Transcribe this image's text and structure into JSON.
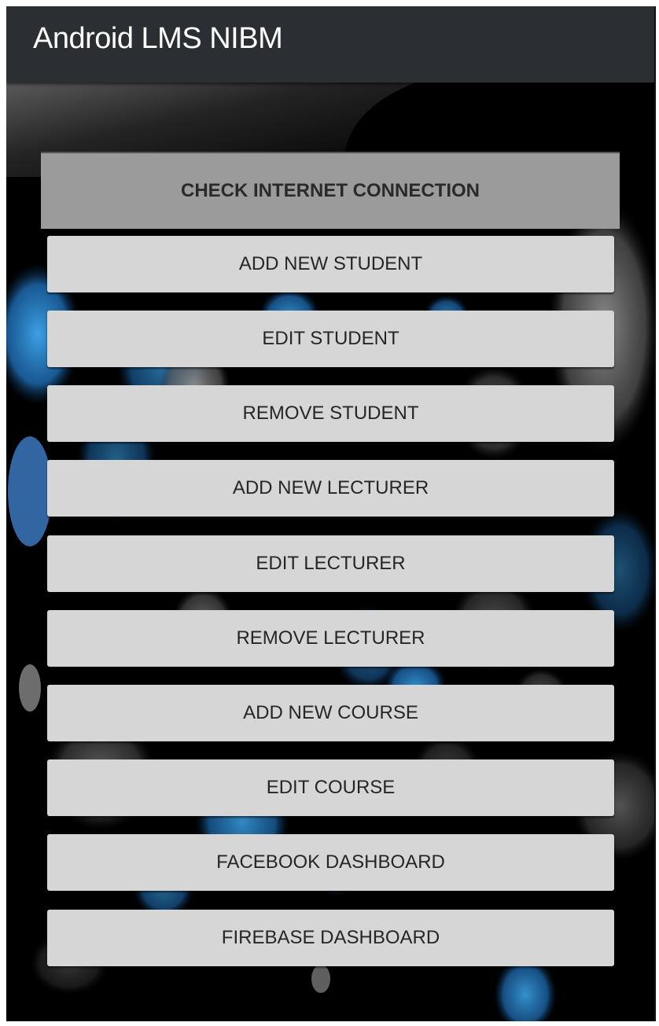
{
  "app_bar": {
    "title": "Android LMS NIBM"
  },
  "check_connection_label": "CHECK INTERNET CONNECTION",
  "menu": [
    {
      "id": "add-new-student",
      "label": "ADD NEW STUDENT"
    },
    {
      "id": "edit-student",
      "label": "EDIT STUDENT"
    },
    {
      "id": "remove-student",
      "label": "REMOVE STUDENT"
    },
    {
      "id": "add-new-lecturer",
      "label": "ADD NEW LECTURER"
    },
    {
      "id": "edit-lecturer",
      "label": "EDIT LECTURER"
    },
    {
      "id": "remove-lecturer",
      "label": "REMOVE LECTURER"
    },
    {
      "id": "add-new-course",
      "label": "ADD NEW COURSE"
    },
    {
      "id": "edit-course",
      "label": "EDIT COURSE"
    },
    {
      "id": "facebook-dashboard",
      "label": "FACEBOOK DASHBOARD"
    },
    {
      "id": "firebase-dashboard",
      "label": "FIREBASE DASHBOARD"
    }
  ],
  "colors": {
    "app_bar": "#2b2f33",
    "button": "#d6d6d6",
    "header_strip": "#9b9b9b",
    "bokeh_blue": "#2a8fd8",
    "background": "#000000"
  }
}
